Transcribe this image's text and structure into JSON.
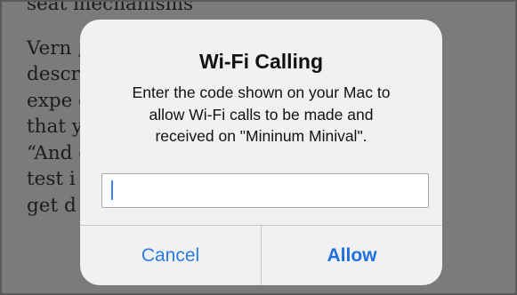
{
  "background": {
    "lines": [
      "seat mechanisms",
      "",
      "Vern                                            ,",
      "descr",
      "expe                                          ea",
      "that y                                       aid.",
      "“And                                       eople",
      "test i                                       to",
      "get d"
    ]
  },
  "dialog": {
    "title": "Wi-Fi Calling",
    "message_lines": [
      "Enter the code shown on your Mac to",
      "allow Wi-Fi calls to be made and",
      "received on \"Mininum Minival\"."
    ],
    "input": {
      "value": "",
      "placeholder": ""
    },
    "buttons": {
      "cancel_label": "Cancel",
      "allow_label": "Allow"
    }
  },
  "colors": {
    "accent": "#1f6fde",
    "dialog_background": "#f1f1f1",
    "dim_overlay": "#7b7b7b"
  }
}
